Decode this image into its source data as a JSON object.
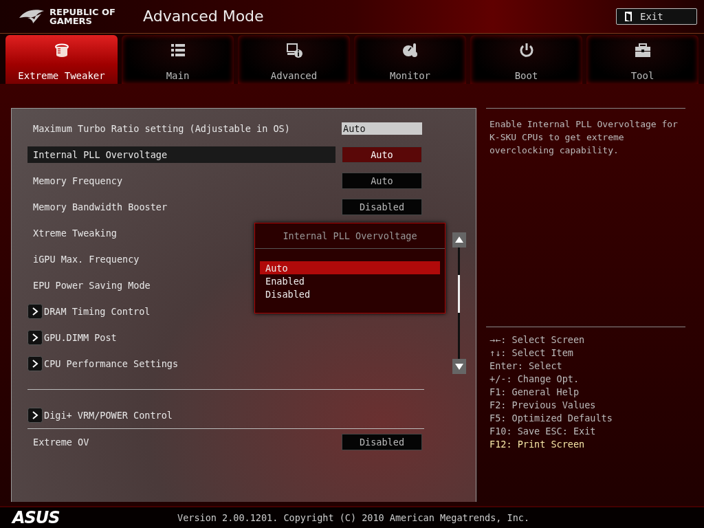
{
  "header": {
    "brand_line_1": "REPUBLIC OF",
    "brand_line_2": "GAMERS",
    "title": "Advanced Mode",
    "exit_button": "Exit"
  },
  "tabs": [
    {
      "label": "Extreme Tweaker",
      "selected": true
    },
    {
      "label": "Main",
      "selected": false
    },
    {
      "label": "Advanced",
      "selected": false
    },
    {
      "label": "Monitor",
      "selected": false
    },
    {
      "label": "Boot",
      "selected": false
    },
    {
      "label": "Tool",
      "selected": false
    }
  ],
  "settings": [
    {
      "kind": "field",
      "label": "Maximum Turbo Ratio setting (Adjustable in OS)",
      "value": "Auto",
      "selected": false
    },
    {
      "kind": "option",
      "label": "Internal PLL Overvoltage",
      "value": "Auto",
      "selected": true
    },
    {
      "kind": "option",
      "label": "Memory Frequency",
      "value": "Auto",
      "selected": false
    },
    {
      "kind": "option",
      "label": "Memory Bandwidth Booster",
      "value": "Disabled",
      "selected": false
    },
    {
      "kind": "option",
      "label": "Xtreme Tweaking",
      "selected": false
    },
    {
      "kind": "option",
      "label": "iGPU Max. Frequency",
      "selected": false
    },
    {
      "kind": "option",
      "label": "EPU Power Saving Mode",
      "selected": false
    },
    {
      "kind": "submenu",
      "label": "DRAM Timing Control",
      "selected": false
    },
    {
      "kind": "submenu",
      "label": "GPU.DIMM Post",
      "selected": false
    },
    {
      "kind": "submenu",
      "label": "CPU Performance Settings",
      "selected": false
    },
    {
      "kind": "separator"
    },
    {
      "kind": "submenu",
      "label": "Digi+ VRM/POWER Control",
      "selected": false
    },
    {
      "kind": "separator"
    },
    {
      "kind": "option",
      "label": "Extreme OV",
      "value": "Disabled",
      "selected": false
    }
  ],
  "popup": {
    "title": "Internal PLL Overvoltage",
    "options": [
      {
        "label": "Auto",
        "selected": true
      },
      {
        "label": "Enabled",
        "selected": false
      },
      {
        "label": "Disabled",
        "selected": false
      }
    ]
  },
  "help": {
    "description": "Enable Internal PLL Overvoltage for K-SKU CPUs to get extreme overclocking capability.",
    "keys": [
      {
        "text": "→←: Select Screen",
        "kind": "normal"
      },
      {
        "text": "↑↓: Select Item",
        "kind": "normal"
      },
      {
        "text": "Enter: Select",
        "kind": "normal"
      },
      {
        "text": "+/-: Change Opt.",
        "kind": "normal"
      },
      {
        "text": "F1: General Help",
        "kind": "normal"
      },
      {
        "text": "F2: Previous Values",
        "kind": "normal"
      },
      {
        "text": "F5: Optimized Defaults",
        "kind": "normal"
      },
      {
        "text": "F10: Save  ESC: Exit",
        "kind": "normal"
      },
      {
        "text": "F12: Print Screen",
        "kind": "highlight"
      }
    ]
  },
  "footer": {
    "logo": "ASUS",
    "version": "Version 2.00.1201. Copyright (C) 2010 American Megatrends, Inc."
  }
}
